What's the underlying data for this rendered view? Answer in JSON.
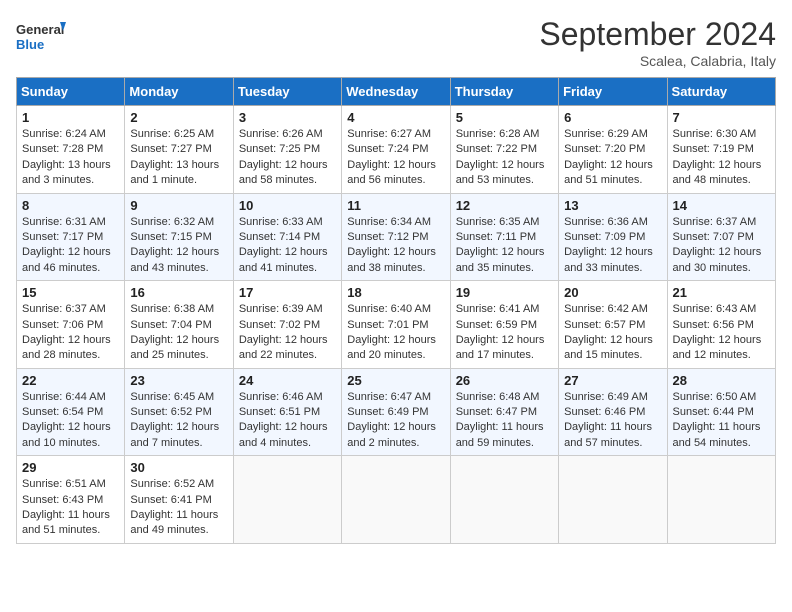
{
  "header": {
    "logo_line1": "General",
    "logo_line2": "Blue",
    "month": "September 2024",
    "location": "Scalea, Calabria, Italy"
  },
  "columns": [
    "Sunday",
    "Monday",
    "Tuesday",
    "Wednesday",
    "Thursday",
    "Friday",
    "Saturday"
  ],
  "weeks": [
    [
      {
        "day": "1",
        "sunrise": "Sunrise: 6:24 AM",
        "sunset": "Sunset: 7:28 PM",
        "daylight": "Daylight: 13 hours and 3 minutes."
      },
      {
        "day": "2",
        "sunrise": "Sunrise: 6:25 AM",
        "sunset": "Sunset: 7:27 PM",
        "daylight": "Daylight: 13 hours and 1 minute."
      },
      {
        "day": "3",
        "sunrise": "Sunrise: 6:26 AM",
        "sunset": "Sunset: 7:25 PM",
        "daylight": "Daylight: 12 hours and 58 minutes."
      },
      {
        "day": "4",
        "sunrise": "Sunrise: 6:27 AM",
        "sunset": "Sunset: 7:24 PM",
        "daylight": "Daylight: 12 hours and 56 minutes."
      },
      {
        "day": "5",
        "sunrise": "Sunrise: 6:28 AM",
        "sunset": "Sunset: 7:22 PM",
        "daylight": "Daylight: 12 hours and 53 minutes."
      },
      {
        "day": "6",
        "sunrise": "Sunrise: 6:29 AM",
        "sunset": "Sunset: 7:20 PM",
        "daylight": "Daylight: 12 hours and 51 minutes."
      },
      {
        "day": "7",
        "sunrise": "Sunrise: 6:30 AM",
        "sunset": "Sunset: 7:19 PM",
        "daylight": "Daylight: 12 hours and 48 minutes."
      }
    ],
    [
      {
        "day": "8",
        "sunrise": "Sunrise: 6:31 AM",
        "sunset": "Sunset: 7:17 PM",
        "daylight": "Daylight: 12 hours and 46 minutes."
      },
      {
        "day": "9",
        "sunrise": "Sunrise: 6:32 AM",
        "sunset": "Sunset: 7:15 PM",
        "daylight": "Daylight: 12 hours and 43 minutes."
      },
      {
        "day": "10",
        "sunrise": "Sunrise: 6:33 AM",
        "sunset": "Sunset: 7:14 PM",
        "daylight": "Daylight: 12 hours and 41 minutes."
      },
      {
        "day": "11",
        "sunrise": "Sunrise: 6:34 AM",
        "sunset": "Sunset: 7:12 PM",
        "daylight": "Daylight: 12 hours and 38 minutes."
      },
      {
        "day": "12",
        "sunrise": "Sunrise: 6:35 AM",
        "sunset": "Sunset: 7:11 PM",
        "daylight": "Daylight: 12 hours and 35 minutes."
      },
      {
        "day": "13",
        "sunrise": "Sunrise: 6:36 AM",
        "sunset": "Sunset: 7:09 PM",
        "daylight": "Daylight: 12 hours and 33 minutes."
      },
      {
        "day": "14",
        "sunrise": "Sunrise: 6:37 AM",
        "sunset": "Sunset: 7:07 PM",
        "daylight": "Daylight: 12 hours and 30 minutes."
      }
    ],
    [
      {
        "day": "15",
        "sunrise": "Sunrise: 6:37 AM",
        "sunset": "Sunset: 7:06 PM",
        "daylight": "Daylight: 12 hours and 28 minutes."
      },
      {
        "day": "16",
        "sunrise": "Sunrise: 6:38 AM",
        "sunset": "Sunset: 7:04 PM",
        "daylight": "Daylight: 12 hours and 25 minutes."
      },
      {
        "day": "17",
        "sunrise": "Sunrise: 6:39 AM",
        "sunset": "Sunset: 7:02 PM",
        "daylight": "Daylight: 12 hours and 22 minutes."
      },
      {
        "day": "18",
        "sunrise": "Sunrise: 6:40 AM",
        "sunset": "Sunset: 7:01 PM",
        "daylight": "Daylight: 12 hours and 20 minutes."
      },
      {
        "day": "19",
        "sunrise": "Sunrise: 6:41 AM",
        "sunset": "Sunset: 6:59 PM",
        "daylight": "Daylight: 12 hours and 17 minutes."
      },
      {
        "day": "20",
        "sunrise": "Sunrise: 6:42 AM",
        "sunset": "Sunset: 6:57 PM",
        "daylight": "Daylight: 12 hours and 15 minutes."
      },
      {
        "day": "21",
        "sunrise": "Sunrise: 6:43 AM",
        "sunset": "Sunset: 6:56 PM",
        "daylight": "Daylight: 12 hours and 12 minutes."
      }
    ],
    [
      {
        "day": "22",
        "sunrise": "Sunrise: 6:44 AM",
        "sunset": "Sunset: 6:54 PM",
        "daylight": "Daylight: 12 hours and 10 minutes."
      },
      {
        "day": "23",
        "sunrise": "Sunrise: 6:45 AM",
        "sunset": "Sunset: 6:52 PM",
        "daylight": "Daylight: 12 hours and 7 minutes."
      },
      {
        "day": "24",
        "sunrise": "Sunrise: 6:46 AM",
        "sunset": "Sunset: 6:51 PM",
        "daylight": "Daylight: 12 hours and 4 minutes."
      },
      {
        "day": "25",
        "sunrise": "Sunrise: 6:47 AM",
        "sunset": "Sunset: 6:49 PM",
        "daylight": "Daylight: 12 hours and 2 minutes."
      },
      {
        "day": "26",
        "sunrise": "Sunrise: 6:48 AM",
        "sunset": "Sunset: 6:47 PM",
        "daylight": "Daylight: 11 hours and 59 minutes."
      },
      {
        "day": "27",
        "sunrise": "Sunrise: 6:49 AM",
        "sunset": "Sunset: 6:46 PM",
        "daylight": "Daylight: 11 hours and 57 minutes."
      },
      {
        "day": "28",
        "sunrise": "Sunrise: 6:50 AM",
        "sunset": "Sunset: 6:44 PM",
        "daylight": "Daylight: 11 hours and 54 minutes."
      }
    ],
    [
      {
        "day": "29",
        "sunrise": "Sunrise: 6:51 AM",
        "sunset": "Sunset: 6:43 PM",
        "daylight": "Daylight: 11 hours and 51 minutes."
      },
      {
        "day": "30",
        "sunrise": "Sunrise: 6:52 AM",
        "sunset": "Sunset: 6:41 PM",
        "daylight": "Daylight: 11 hours and 49 minutes."
      },
      null,
      null,
      null,
      null,
      null
    ]
  ]
}
